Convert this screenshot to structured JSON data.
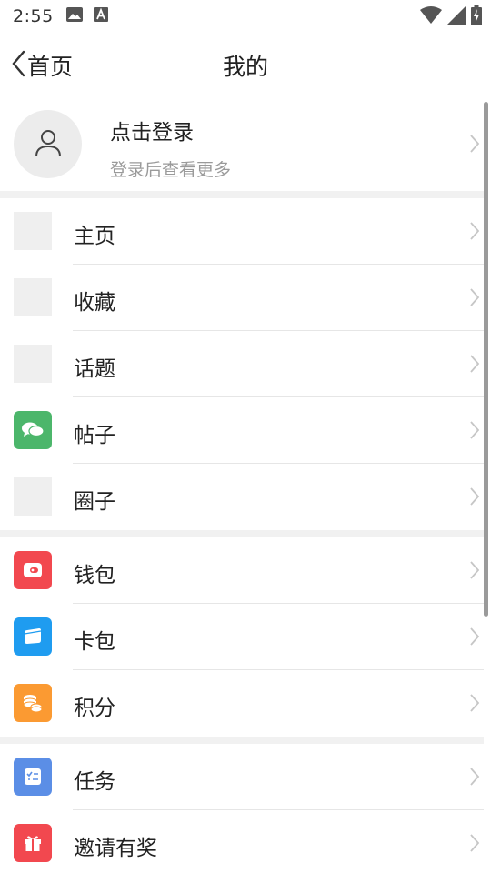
{
  "status_bar": {
    "time": "2:55",
    "left_icons": [
      "image-icon",
      "a-notification-icon"
    ],
    "right_icons": [
      "wifi-icon",
      "cell-signal-icon",
      "battery-charging-icon"
    ]
  },
  "nav": {
    "back_label": "首页",
    "title": "我的"
  },
  "profile": {
    "title": "点击登录",
    "subtitle": "登录后查看更多",
    "avatar_icon": "user-icon"
  },
  "groups": [
    {
      "items": [
        {
          "label": "主页",
          "icon": "placeholder"
        },
        {
          "label": "收藏",
          "icon": "placeholder"
        },
        {
          "label": "话题",
          "icon": "placeholder"
        },
        {
          "label": "帖子",
          "icon": "chat-bubbles-icon",
          "color": "#4cb66b"
        },
        {
          "label": "圈子",
          "icon": "placeholder"
        }
      ]
    },
    {
      "items": [
        {
          "label": "钱包",
          "icon": "wallet-icon",
          "color": "#f2484f"
        },
        {
          "label": "卡包",
          "icon": "card-icon",
          "color": "#1f9cf0"
        },
        {
          "label": "积分",
          "icon": "coins-icon",
          "color": "#fb9a32"
        }
      ]
    },
    {
      "items": [
        {
          "label": "任务",
          "icon": "task-list-icon",
          "color": "#5b8ee6"
        },
        {
          "label": "邀请有奖",
          "icon": "gift-icon",
          "color": "#f2484f"
        }
      ]
    }
  ],
  "colors": {
    "separator": "#f1f1f1",
    "divider": "#e6e6e6",
    "subtext": "#9a9a9a",
    "arrow": "#c6c6c6"
  }
}
